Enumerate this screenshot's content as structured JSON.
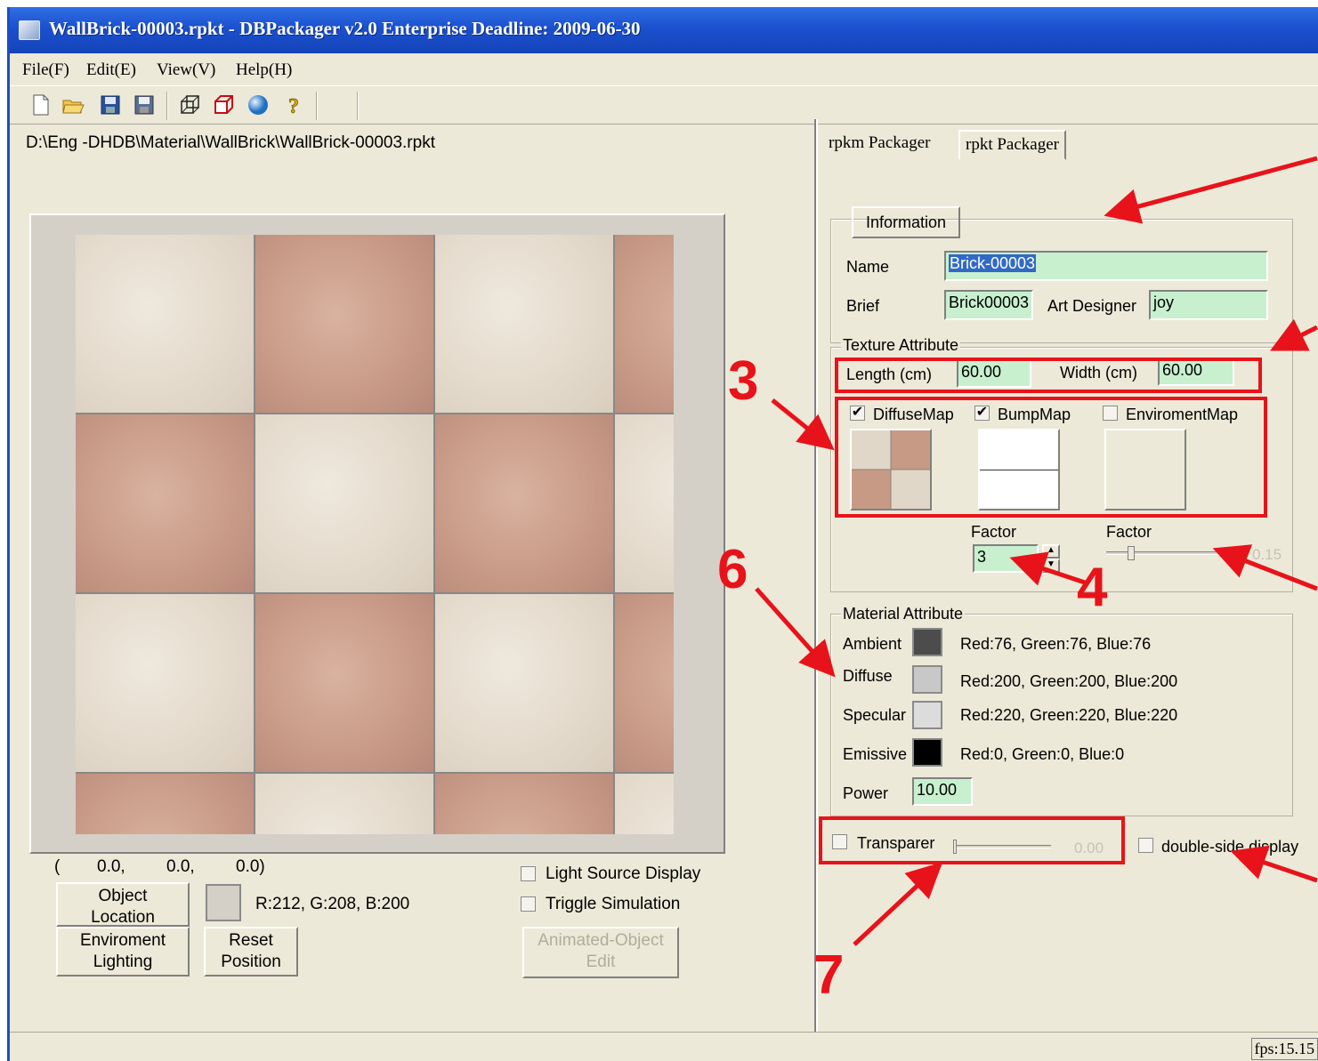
{
  "window": {
    "title": "WallBrick-00003.rpkt - DBPackager v2.0 Enterprise Deadline: 2009-06-30"
  },
  "menu": [
    {
      "label": "File(F)"
    },
    {
      "label": "Edit(E)"
    },
    {
      "label": "View(V)"
    },
    {
      "label": "Help(H)"
    }
  ],
  "toolbar": {
    "icons": [
      "new-file-icon",
      "open-folder-icon",
      "save-icon",
      "save-as-icon",
      "wireframe-icon",
      "cube-icon",
      "sphere-icon",
      "help-icon"
    ]
  },
  "left": {
    "path": "D:\\Eng -DHDB\\Material\\WallBrick\\WallBrick-00003.rpkt",
    "coords": {
      "open": "(",
      "x": "0.0,",
      "y": "0.0,",
      "z": "0.0)"
    },
    "object_location_l1": "Object",
    "object_location_l2": "Location",
    "env_lighting_l1": "Enviroment",
    "env_lighting_l2": "Lighting",
    "reset_l1": "Reset",
    "reset_l2": "Position",
    "rgb_readout": "R:212, G:208, B:200",
    "light_source_label": "Light Source Display",
    "triggle_label": "Triggle Simulation",
    "animated_l1": "Animated-Object",
    "animated_l2": "Edit"
  },
  "right": {
    "tabs": [
      {
        "label": "rpkm Packager"
      },
      {
        "label": "rpkt Packager"
      }
    ],
    "info_tab": "Information",
    "name_label": "Name",
    "name_value": "Brick-00003",
    "brief_label": "Brief",
    "brief_value": "Brick00003",
    "designer_label": "Art Designer",
    "designer_value": "joy",
    "texture_title": "Texture Attribute",
    "length_label": "Length (cm)",
    "length_value": "60.00",
    "width_label": "Width (cm)",
    "width_value": "60.00",
    "diffuse_map_label": "DiffuseMap",
    "diffuse_map_checked": true,
    "bump_map_label": "BumpMap",
    "bump_map_checked": true,
    "env_map_label": "EnviromentMap",
    "env_map_checked": false,
    "factor_label_1": "Factor",
    "factor_value_1": "3",
    "factor_label_2": "Factor",
    "factor_value_2": "0.15",
    "factor_level_2": 0.15,
    "material_title": "Material Attribute",
    "ambient_label": "Ambient",
    "ambient_color": "#4c4c4c",
    "ambient_values": "Red:76,  Green:76,  Blue:76",
    "diffuse_label": "Diffuse",
    "diffuse_color": "#c8c8c8",
    "diffuse_values": "Red:200,  Green:200,  Blue:200",
    "specular_label": "Specular",
    "specular_color": "#dcdcdc",
    "specular_values": "Red:220,  Green:220,  Blue:220",
    "emissive_label": "Emissive",
    "emissive_color": "#000000",
    "emissive_values": "Red:0,  Green:0,  Blue:0",
    "power_label": "Power",
    "power_value": "10.00",
    "transparent_label": "Transparer",
    "transparent_value": "0.00",
    "transparent_level": 0.0,
    "double_side_label": "double-side display"
  },
  "annotations": {
    "c3": "3",
    "c4": "4",
    "c6": "6",
    "c7": "7",
    "color": "#e8131a"
  },
  "status": {
    "fps": "fps:15.15"
  }
}
